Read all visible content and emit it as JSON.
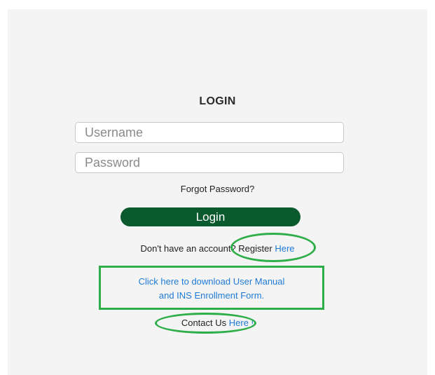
{
  "login": {
    "title": "LOGIN",
    "username_placeholder": "Username",
    "password_placeholder": "Password",
    "forgot_password": "Forgot Password?",
    "login_button": "Login"
  },
  "register": {
    "prefix": "Don't have an account? Register",
    "link": "Here"
  },
  "download": {
    "line1": "Click here to download User Manual",
    "line2": "and INS Enrollment Form."
  },
  "contact": {
    "prefix": "Contact Us",
    "link": "Here !"
  },
  "colors": {
    "button": "#0b5a2d",
    "link": "#1f7ad8",
    "annotation": "#2eae49",
    "panel": "#f4f4f4"
  }
}
